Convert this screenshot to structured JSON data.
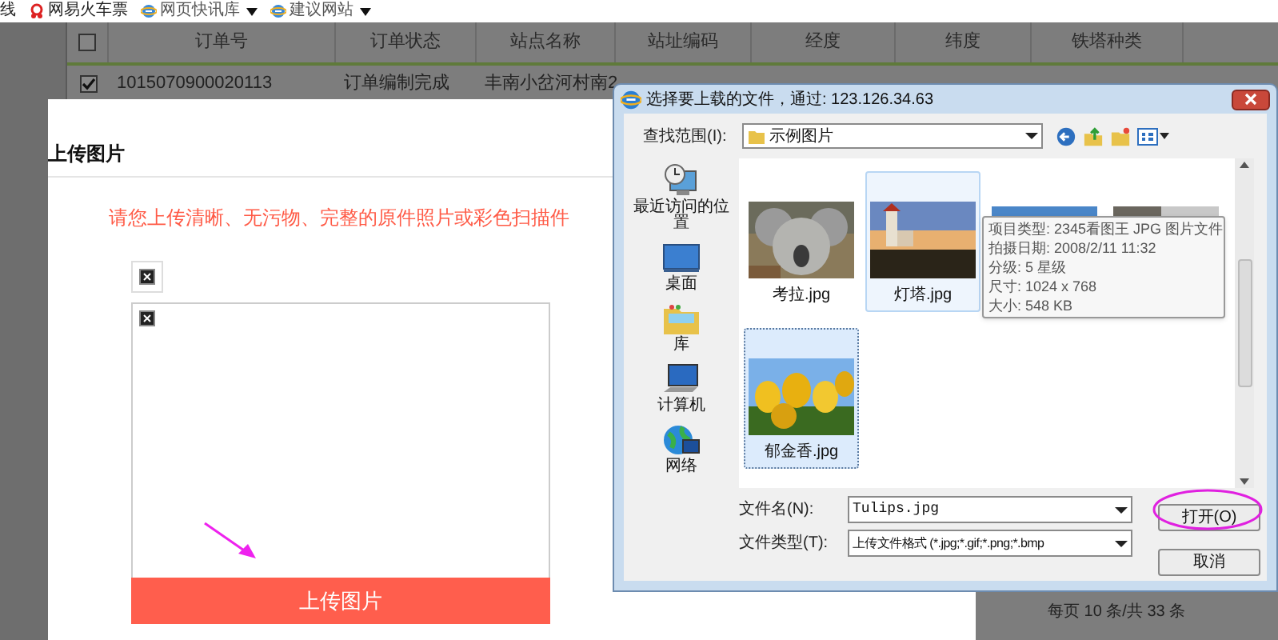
{
  "toolbar": {
    "cut_text": "线",
    "links": [
      {
        "label": "网易火车票",
        "kind": "plain"
      },
      {
        "label": "网页快讯库",
        "kind": "dropdown"
      },
      {
        "label": "建议网站",
        "kind": "dropdown"
      }
    ]
  },
  "table": {
    "header_checked": false,
    "columns": [
      "订单号",
      "订单状态",
      "站点名称",
      "站址编码",
      "经度",
      "纬度",
      "铁塔种类"
    ],
    "rows": [
      {
        "checked": true,
        "cells": [
          "1015070900020113",
          "订单编制完成",
          "丰南小岔河村南2"
        ]
      }
    ]
  },
  "pager": "每页 10 条/共 33 条",
  "upload_modal": {
    "title": "上传图片",
    "notice": "请您上传清晰、无污物、完整的原件照片或彩色扫描件",
    "button": "上传图片"
  },
  "file_dialog": {
    "title": "选择要上载的文件，通过: 123.126.34.63",
    "look_in_label": "查找范围(I):",
    "look_in": "示例图片",
    "places": [
      {
        "label": "最近访问的位置",
        "kind": "recent"
      },
      {
        "label": "桌面",
        "kind": "desktop"
      },
      {
        "label": "库",
        "kind": "library"
      },
      {
        "label": "计算机",
        "kind": "computer"
      },
      {
        "label": "网络",
        "kind": "network"
      }
    ],
    "files": [
      {
        "name": "考拉.jpg",
        "selected": false,
        "hover": false
      },
      {
        "name": "灯塔.jpg",
        "selected": false,
        "hover": true
      },
      {
        "selected": false,
        "hover": false
      },
      {
        "selected": false,
        "hover": false
      },
      {
        "name": "郁金香.jpg",
        "selected": true,
        "hover": false
      }
    ],
    "tooltip": [
      "项目类型: 2345看图王 JPG 图片文件",
      "拍摄日期: 2008/2/11 11:32",
      "分级: 5 星级",
      "尺寸: 1024 x 768",
      "大小: 548 KB"
    ],
    "file_name_label": "文件名(N):",
    "file_name": "Tulips.jpg",
    "file_type_label": "文件类型(T):",
    "file_type": "上传文件格式 (*.jpg;*.gif;*.png;*.bmp",
    "buttons": [
      {
        "label": "打开(O)",
        "highlighted": true
      },
      {
        "label": "取消",
        "highlighted": false
      }
    ]
  }
}
